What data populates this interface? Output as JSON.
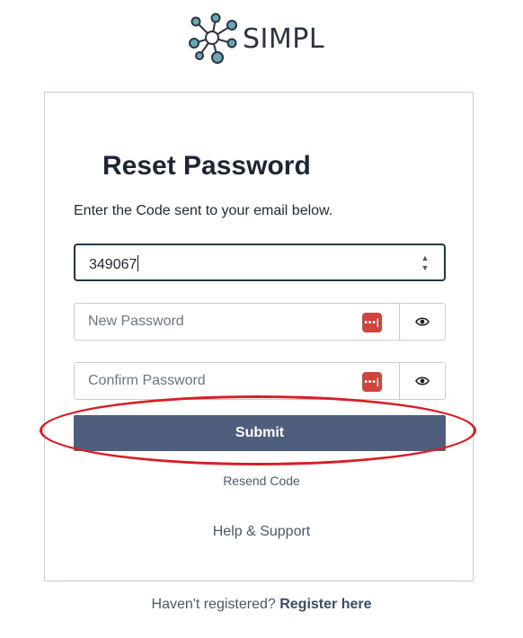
{
  "brand": {
    "name": "SIMPL",
    "icon": "molecule-logo-icon",
    "node_color": "#6aa6b3"
  },
  "page": {
    "title": "Reset Password",
    "subtitle": "Enter the Code sent to your email below."
  },
  "form": {
    "code_value": "349067",
    "new_password_placeholder": "New Password",
    "confirm_password_placeholder": "Confirm Password",
    "password_manager_icon": "password-key-icon",
    "show_password_icon": "eye-icon",
    "submit_label": "Submit",
    "submit_color": "#505e7d"
  },
  "links": {
    "resend": "Resend Code",
    "help": "Help & Support",
    "register_prompt": "Haven't registered?",
    "register_link": "Register here"
  },
  "annotation": {
    "color": "#d81f26"
  }
}
